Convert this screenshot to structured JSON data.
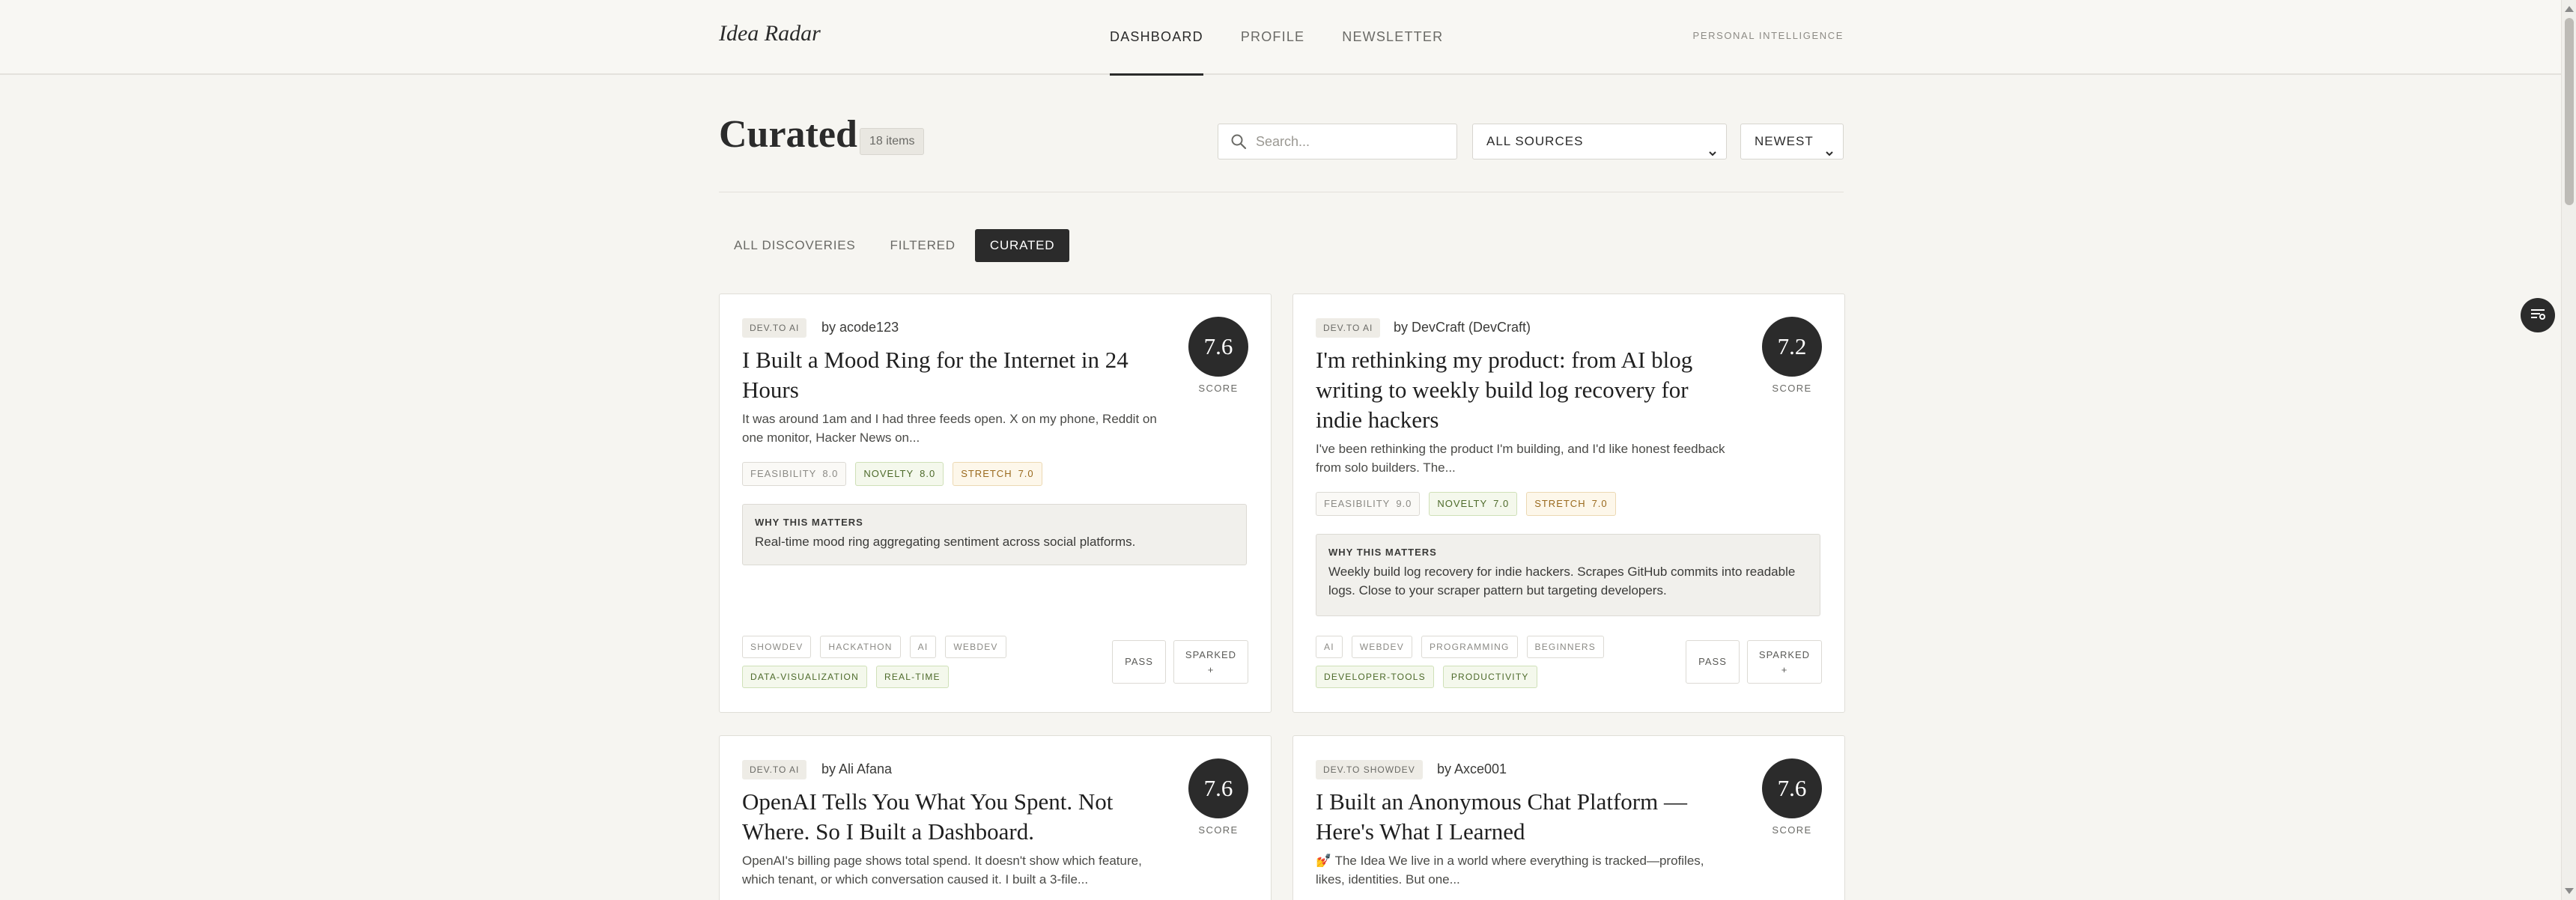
{
  "header": {
    "brand": "Idea Radar",
    "nav": [
      {
        "label": "DASHBOARD",
        "active": true
      },
      {
        "label": "PROFILE",
        "active": false
      },
      {
        "label": "NEWSLETTER",
        "active": false
      }
    ],
    "tagline": "PERSONAL INTELLIGENCE"
  },
  "page": {
    "title": "Curated",
    "count": "18 items",
    "search_placeholder": "Search...",
    "source_filter": "ALL SOURCES",
    "sort": "NEWEST"
  },
  "tabs": [
    {
      "label": "ALL DISCOVERIES",
      "active": false
    },
    {
      "label": "FILTERED",
      "active": false
    },
    {
      "label": "CURATED",
      "active": true
    }
  ],
  "labels": {
    "score": "SCORE",
    "why": "WHY THIS MATTERS",
    "feasibility": "FEASIBILITY",
    "novelty": "NOVELTY",
    "stretch": "STRETCH",
    "pass": "PASS",
    "sparked": "SPARKED",
    "plus": "+"
  },
  "cards": [
    {
      "source": "DEV.TO AI",
      "author": "by acode123",
      "title": "I Built a Mood Ring for the Internet in 24 Hours",
      "excerpt": "It was around 1am and I had three feeds open. X on my phone, Reddit on one monitor, Hacker News on...",
      "score": "7.6",
      "feasibility": "8.0",
      "novelty": "8.0",
      "stretch": "7.0",
      "why": "Real-time mood ring aggregating sentiment across social platforms.",
      "tags": [
        "SHOWDEV",
        "HACKATHON",
        "AI",
        "WEBDEV"
      ],
      "highlight_tags": [
        "DATA-VISUALIZATION",
        "REAL-TIME"
      ]
    },
    {
      "source": "DEV.TO AI",
      "author": "by DevCraft (DevCraft)",
      "title": "I'm rethinking my product: from AI blog writing to weekly build log recovery for indie hackers",
      "excerpt": "I've been rethinking the product I'm building, and I'd like honest feedback from solo builders. The...",
      "score": "7.2",
      "feasibility": "9.0",
      "novelty": "7.0",
      "stretch": "7.0",
      "why": "Weekly build log recovery for indie hackers. Scrapes GitHub commits into readable logs. Close to your scraper pattern but targeting developers.",
      "tags": [
        "AI",
        "WEBDEV",
        "PROGRAMMING",
        "BEGINNERS"
      ],
      "highlight_tags": [
        "DEVELOPER-TOOLS",
        "PRODUCTIVITY"
      ]
    },
    {
      "source": "DEV.TO AI",
      "author": "by Ali Afana",
      "title": "OpenAI Tells You What You Spent. Not Where. So I Built a Dashboard.",
      "excerpt": "OpenAI's billing page shows total spend. It doesn't show which feature, which tenant, or which conversation caused it. I built a 3-file...",
      "score": "7.6"
    },
    {
      "source": "DEV.TO SHOWDEV",
      "author": "by Axce001",
      "title": "I Built an Anonymous Chat Platform — Here's What I Learned",
      "excerpt": "💅 The Idea We live in a world where everything is tracked—profiles, likes, identities. But one...",
      "score": "7.6"
    }
  ]
}
